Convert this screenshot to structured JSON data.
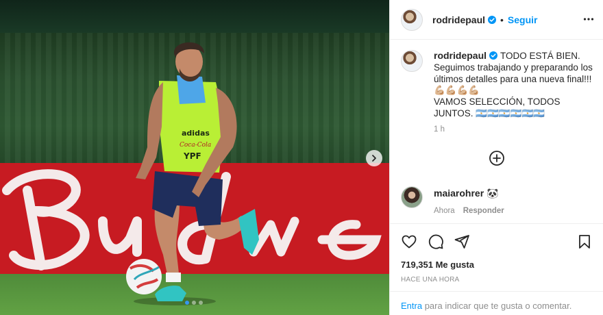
{
  "post": {
    "username": "rodridepaul",
    "follow_label": "Seguir",
    "caption_text": "TODO ESTÁ BIEN.\nSeguimos trabajando y preparando los últimos detalles para una nueva final!!! 💪🏼💪🏼💪🏼💪🏼\nVAMOS SELECCIÓN, TODOS JUNTOS. 🇦🇷🇦🇷🇦🇷🇦🇷🇦🇷🇦🇷",
    "caption_time": "1 h",
    "likes": "719,351 Me gusta",
    "time_ago": "HACE UNA HORA",
    "carousel": {
      "count": 3,
      "active_index": 0
    }
  },
  "comments": [
    {
      "username": "maiarohrer",
      "emoji": "🐼",
      "time": "Ahora",
      "reply_label": "Responder"
    }
  ],
  "add_comment": {
    "enter_label": "Entra",
    "rest_label": " para indicar que te gusta o comentar."
  },
  "icons": {
    "verified": "verified-badge-icon",
    "more": "more-options-icon",
    "like": "heart-icon",
    "comment": "comment-icon",
    "share": "share-icon",
    "save": "bookmark-icon",
    "next": "chevron-right-icon",
    "load_more": "plus-circle-icon"
  },
  "colors": {
    "link": "#0095f6",
    "verified": "#0095f6",
    "secondary_text": "#8e8e8e",
    "board_red": "#c71b22"
  }
}
